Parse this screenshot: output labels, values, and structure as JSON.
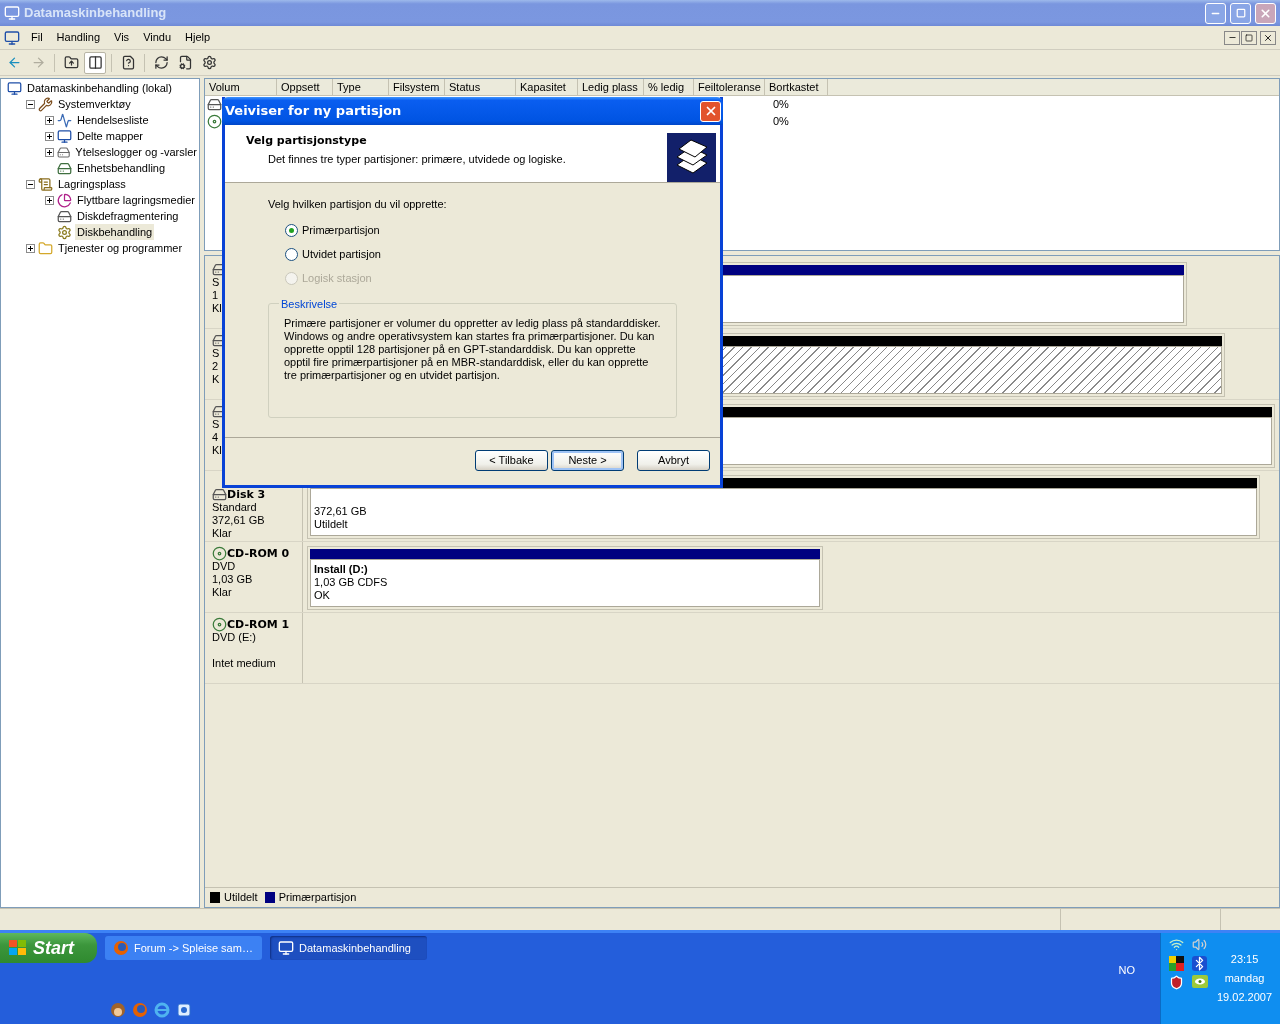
{
  "window": {
    "title": "Datamaskinbehandling"
  },
  "menu": [
    "Fil",
    "Handling",
    "Vis",
    "Vindu",
    "Hjelp"
  ],
  "toolbar": [
    {
      "pressed": false,
      "disabled": false
    },
    {
      "pressed": false,
      "disabled": true
    },
    {
      "pressed": false,
      "disabled": false
    },
    {
      "pressed": true,
      "disabled": false
    },
    {
      "pressed": false,
      "disabled": false
    },
    {
      "pressed": false,
      "disabled": false
    },
    {
      "pressed": false,
      "disabled": false
    },
    {
      "pressed": false,
      "disabled": false
    }
  ],
  "tree": [
    {
      "label": "Datamaskinbehandling (lokal)",
      "selected": false,
      "children": [
        {
          "label": "Systemverktøy",
          "selected": false,
          "expanded": true,
          "children": [
            {
              "label": "Hendelsesliste",
              "selected": false,
              "expanded": false
            },
            {
              "label": "Delte mapper",
              "selected": false,
              "expanded": false
            },
            {
              "label": "Ytelseslogger og -varsler",
              "selected": false,
              "expanded": false
            },
            {
              "label": "Enhetsbehandling",
              "selected": false
            }
          ]
        },
        {
          "label": "Lagringsplass",
          "selected": false,
          "expanded": true,
          "children": [
            {
              "label": "Flyttbare lagringsmedier",
              "selected": false,
              "expanded": false
            },
            {
              "label": "Diskdefragmentering",
              "selected": false
            },
            {
              "label": "Diskbehandling",
              "selected": true
            }
          ]
        },
        {
          "label": "Tjenester og programmer",
          "selected": false,
          "expanded": false
        }
      ]
    }
  ],
  "volume_table": {
    "columns": [
      "Volum",
      "Oppsett",
      "Type",
      "Filsystem",
      "Status",
      "Kapasitet",
      "Ledig plass",
      "% ledig",
      "Feiltoleranse",
      "Bortkastet"
    ],
    "rows": [
      {
        "kind": "disk",
        "bortkastet": "0%"
      },
      {
        "kind": "cdrom",
        "bortkastet": "0%"
      }
    ]
  },
  "disks": [
    {
      "kind": "disk",
      "lines": [
        "S",
        "1",
        "Kl"
      ],
      "partition": {
        "color": "#000080",
        "hatched": false
      }
    },
    {
      "kind": "disk",
      "lines": [
        "S",
        "2",
        "K"
      ],
      "partition": {
        "color": "#000000",
        "hatched": true
      }
    },
    {
      "kind": "disk",
      "lines": [
        "S",
        "4",
        "Kl"
      ],
      "partition": {
        "color": "#000000",
        "hatched": false
      }
    },
    {
      "kind": "disk",
      "name": "Disk 3",
      "lines": [
        "Standard",
        "372,61 GB",
        "Klar"
      ],
      "partition": {
        "color": "#000000",
        "hatched": false,
        "lines": [
          "372,61 GB",
          "Utildelt"
        ]
      }
    },
    {
      "kind": "cdrom",
      "name": "CD-ROM 0",
      "lines": [
        "DVD",
        "1,03 GB",
        "Klar"
      ],
      "partition": {
        "color": "#000080",
        "hatched": false,
        "title": "Install  (D:)",
        "lines": [
          "1,03 GB CDFS",
          "OK"
        ]
      }
    },
    {
      "kind": "cdrom",
      "name": "CD-ROM 1",
      "lines": [
        "DVD (E:)"
      ],
      "status": "Intet medium"
    }
  ],
  "legend": [
    {
      "label": "Utildelt",
      "color": "#000000"
    },
    {
      "label": "Primærpartisjon",
      "color": "#000080"
    }
  ],
  "dialog": {
    "title": "Veiviser for ny partisjon",
    "heading": "Velg partisjonstype",
    "subheading": "Det finnes tre typer partisjoner: primære, utvidede og logiske.",
    "prompt": "Velg hvilken partisjon du vil opprette:",
    "options": [
      {
        "label": "Primærpartisjon",
        "selected": true,
        "disabled": false
      },
      {
        "label": "Utvidet partisjon",
        "selected": false,
        "disabled": false
      },
      {
        "label": "Logisk stasjon",
        "selected": false,
        "disabled": true
      }
    ],
    "group_title": "Beskrivelse",
    "description": "Primære partisjoner er volumer du oppretter av ledig plass på standarddisker. Windows og andre operativsystem kan startes fra primærpartisjoner. Du kan opprette opptil 128 partisjoner på en GPT-standarddisk. Du kan opprette opptil fire primærpartisjoner på en MBR-standarddisk, eller du kan opprette tre primærpartisjoner og en utvidet partisjon.",
    "buttons": [
      {
        "label": "< Tilbake",
        "default": false
      },
      {
        "label": "Neste >",
        "default": true
      },
      {
        "label": "Avbryt",
        "default": false
      }
    ]
  },
  "taskbar": {
    "start": "Start",
    "tasks": [
      {
        "label": "Forum -> Spleise sam…",
        "selected": false
      },
      {
        "label": "Datamaskinbehandling",
        "selected": true
      }
    ],
    "language": "NO",
    "time": "23:15",
    "day": "mandag",
    "date": "19.02.2007"
  }
}
